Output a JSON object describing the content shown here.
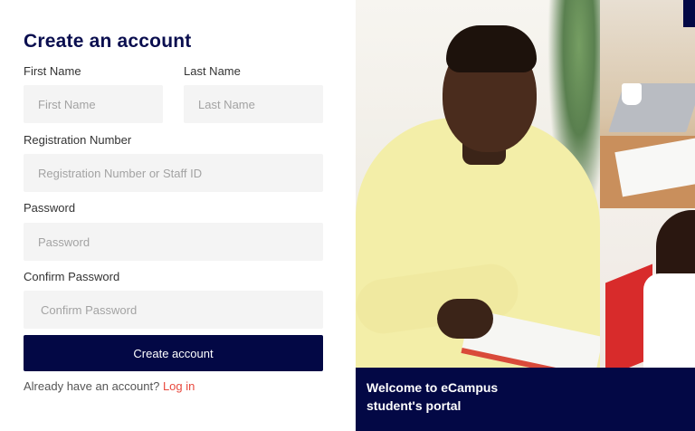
{
  "form": {
    "title": "Create an account",
    "first_name_label": "First Name",
    "first_name_placeholder": "First Name",
    "last_name_label": "Last Name",
    "last_name_placeholder": "Last Name",
    "reg_label": "Registration Number",
    "reg_placeholder": "Registration Number or Staff ID",
    "password_label": "Password",
    "password_placeholder": "Password",
    "confirm_label": "Confirm Password",
    "confirm_placeholder": "Confirm Password",
    "submit_label": "Create account",
    "already_text": "Already have an account?",
    "login_link": "Log in"
  },
  "hero": {
    "caption_line1": "Welcome to eCampus",
    "caption_line2": "student's portal"
  },
  "colors": {
    "navy": "#030845",
    "accent_red": "#e8483d",
    "field_bg": "#f4f4f4"
  }
}
